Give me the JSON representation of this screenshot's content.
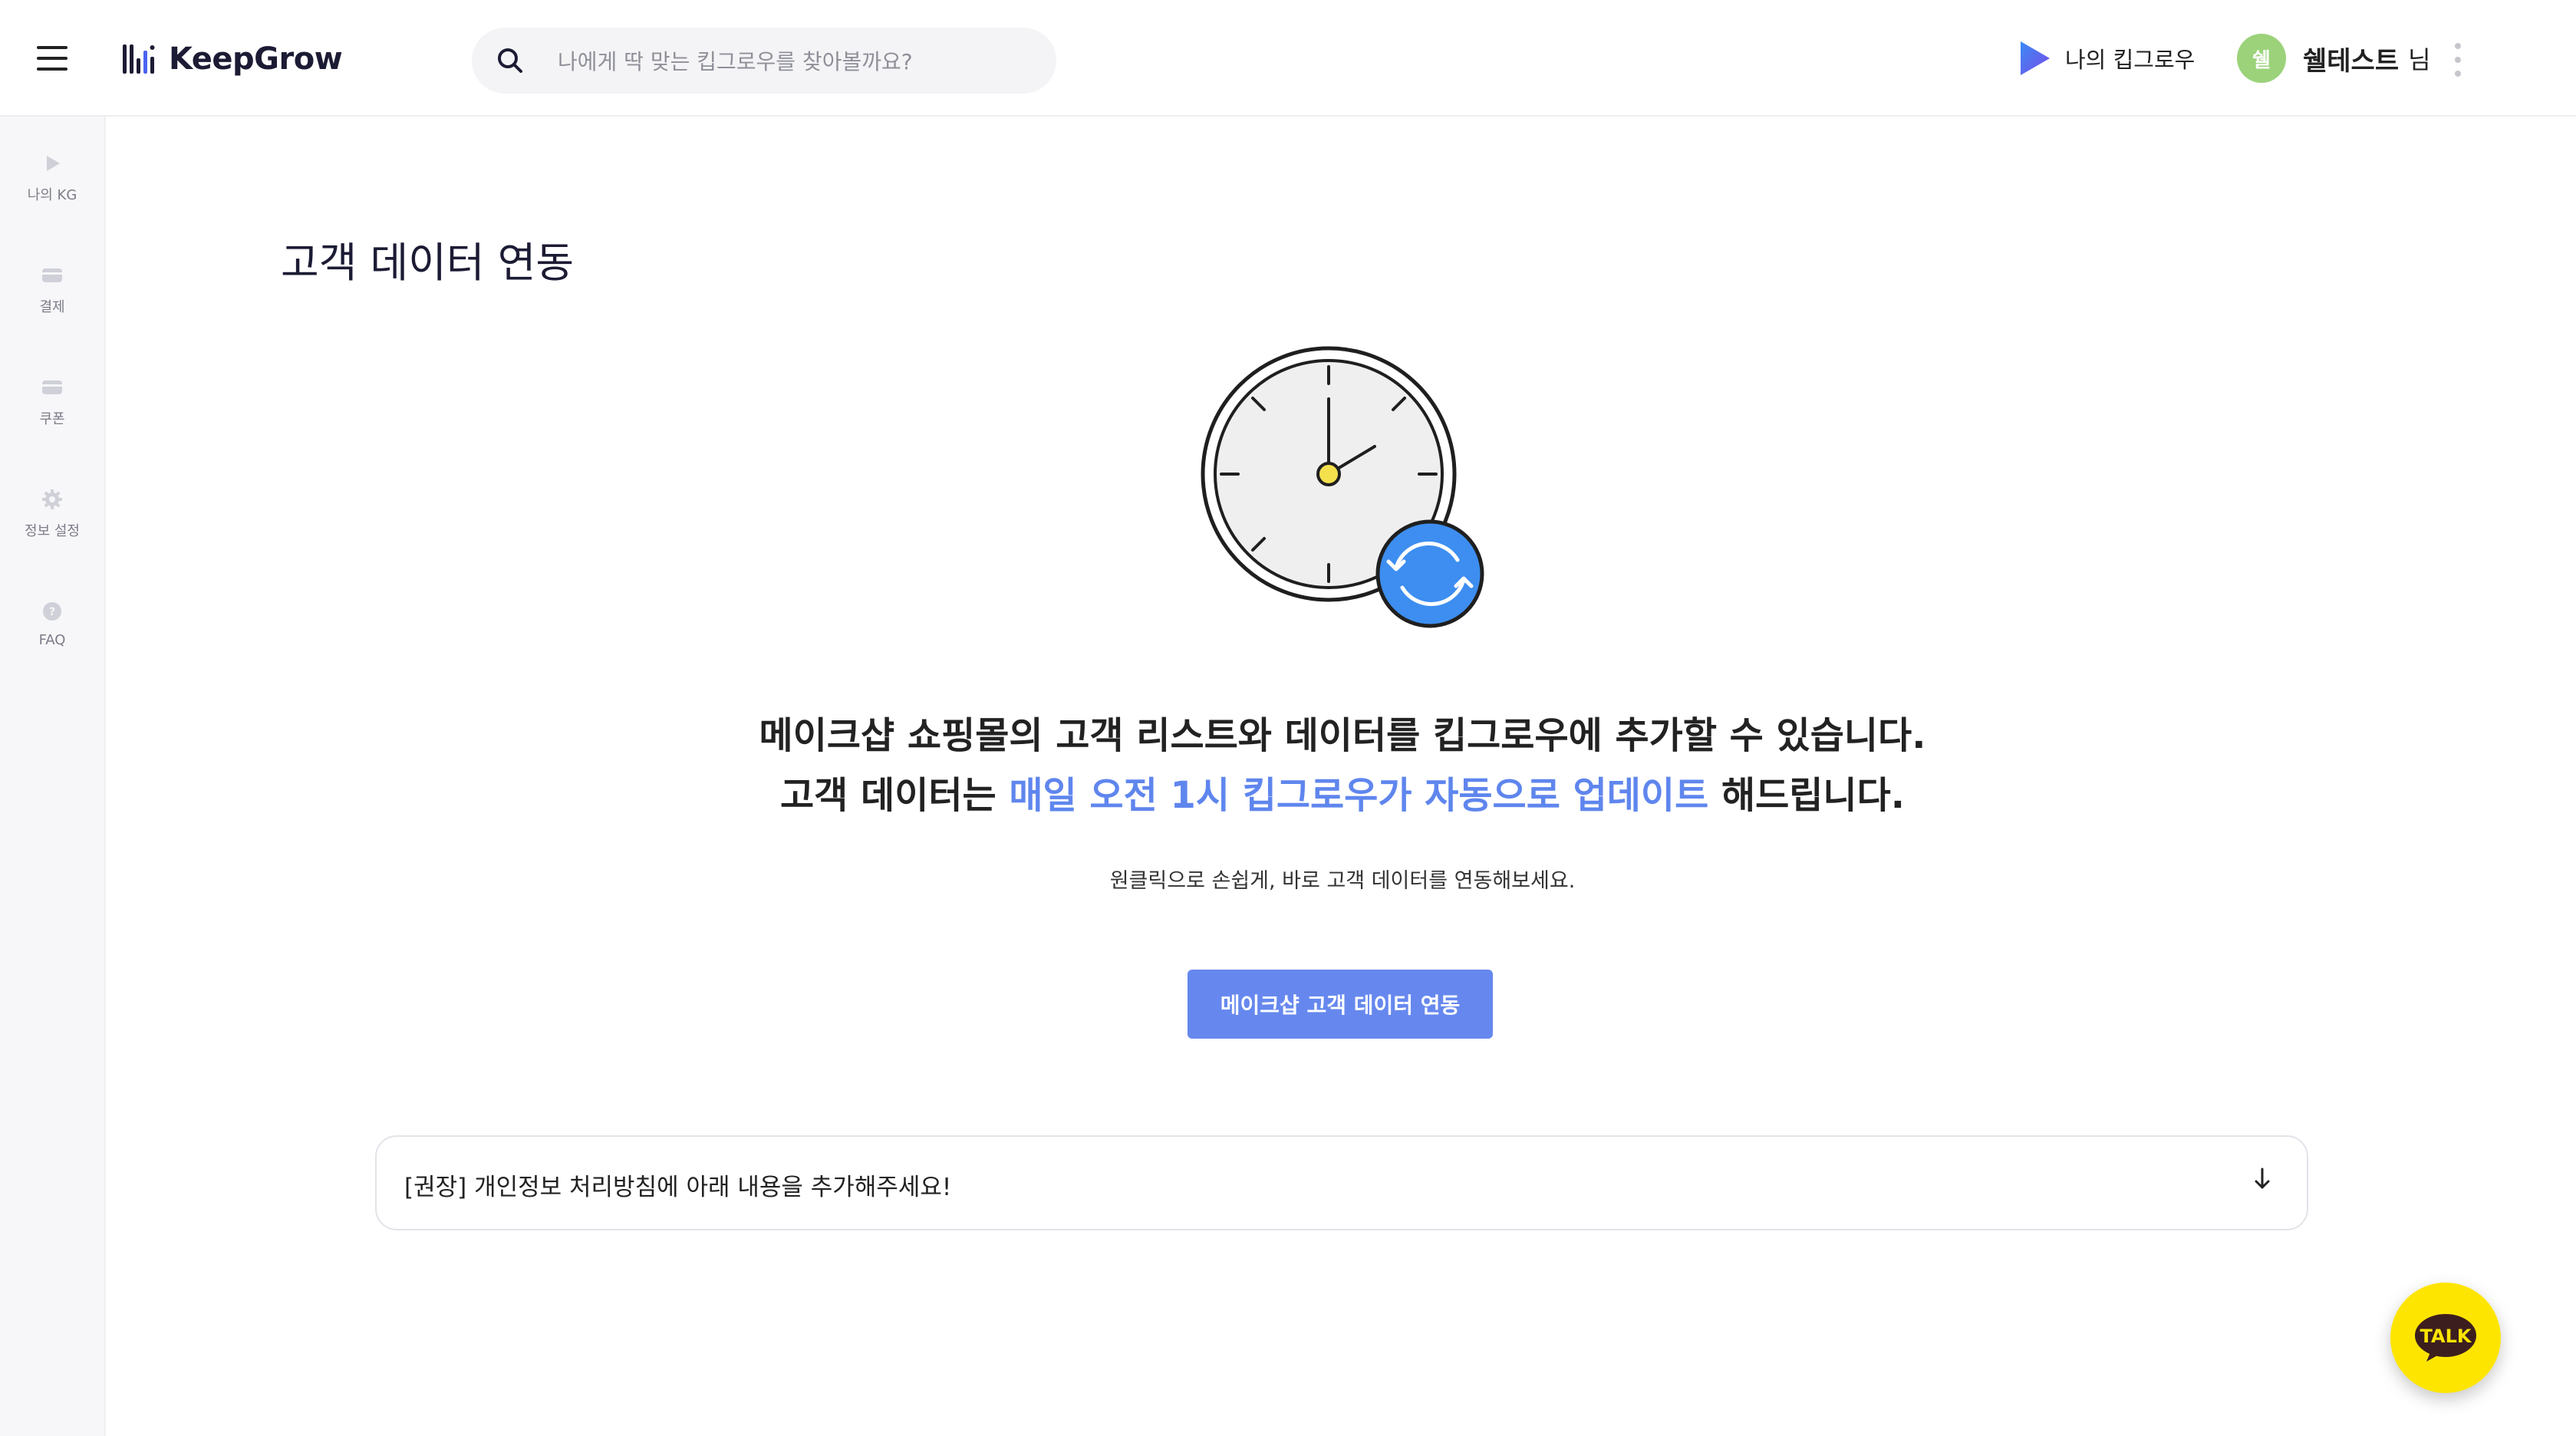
{
  "header": {
    "brand": "KeepGrow",
    "search_placeholder": "나에게 딱 맞는 킵그로우를 찾아볼까요?",
    "my_keepgrow": "나의 킵그로우",
    "user": {
      "avatar_letter": "쉘",
      "name": "쉘테스트",
      "suffix": "님"
    }
  },
  "sidebar": {
    "items": [
      {
        "label": "나의 KG",
        "icon": "play-icon"
      },
      {
        "label": "결제",
        "icon": "card-icon"
      },
      {
        "label": "쿠폰",
        "icon": "coupon-icon"
      },
      {
        "label": "정보 설정",
        "icon": "gear-icon"
      },
      {
        "label": "FAQ",
        "icon": "faq-icon"
      }
    ]
  },
  "main": {
    "title": "고객 데이터 연동",
    "line1": "메이크샵 쇼핑몰의 고객 리스트와 데이터를 킵그로우에 추가할 수 있습니다.",
    "line2_prefix": "고객 데이터는 ",
    "line2_highlight": "매일 오전 1시 킵그로우가 자동으로 업데이트",
    "line2_suffix": " 해드립니다.",
    "subtext": "원클릭으로 손쉽게, 바로 고객 데이터를 연동해보세요.",
    "cta_label": "메이크샵 고객 데이터 연동",
    "accordion_label": "[권장] 개인정보 처리방침에 아래 내용을 추가해주세요!"
  },
  "chat": {
    "label": "TALK"
  },
  "colors": {
    "accent": "#6688ee",
    "highlight_text": "#5f86ee",
    "sync_badge": "#3d8ef0",
    "clock_center": "#f4e04d",
    "talk_bg": "#fee500"
  }
}
